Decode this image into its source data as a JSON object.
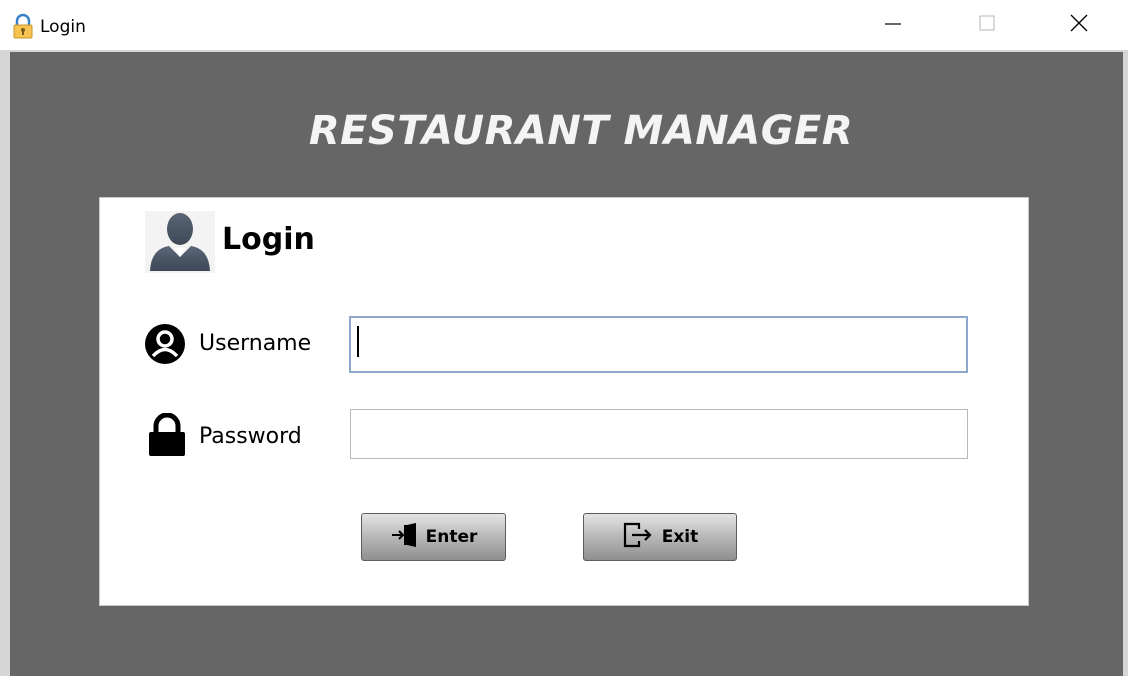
{
  "window": {
    "title": "Login",
    "icon": "lock-icon",
    "controls": {
      "minimize": "minimize-icon",
      "maximize": "maximize-icon",
      "close": "close-icon"
    }
  },
  "app": {
    "title": "RESTAURANT MANAGER"
  },
  "login": {
    "heading": "Login",
    "username": {
      "label": "Username",
      "value": "",
      "placeholder": ""
    },
    "password": {
      "label": "Password",
      "value": "",
      "placeholder": ""
    },
    "buttons": {
      "enter": "Enter",
      "exit": "Exit"
    }
  },
  "colors": {
    "background": "#666666",
    "panel": "#ffffff",
    "title_text": "#f4f4f4",
    "focus_border": "#8ea8cc"
  }
}
